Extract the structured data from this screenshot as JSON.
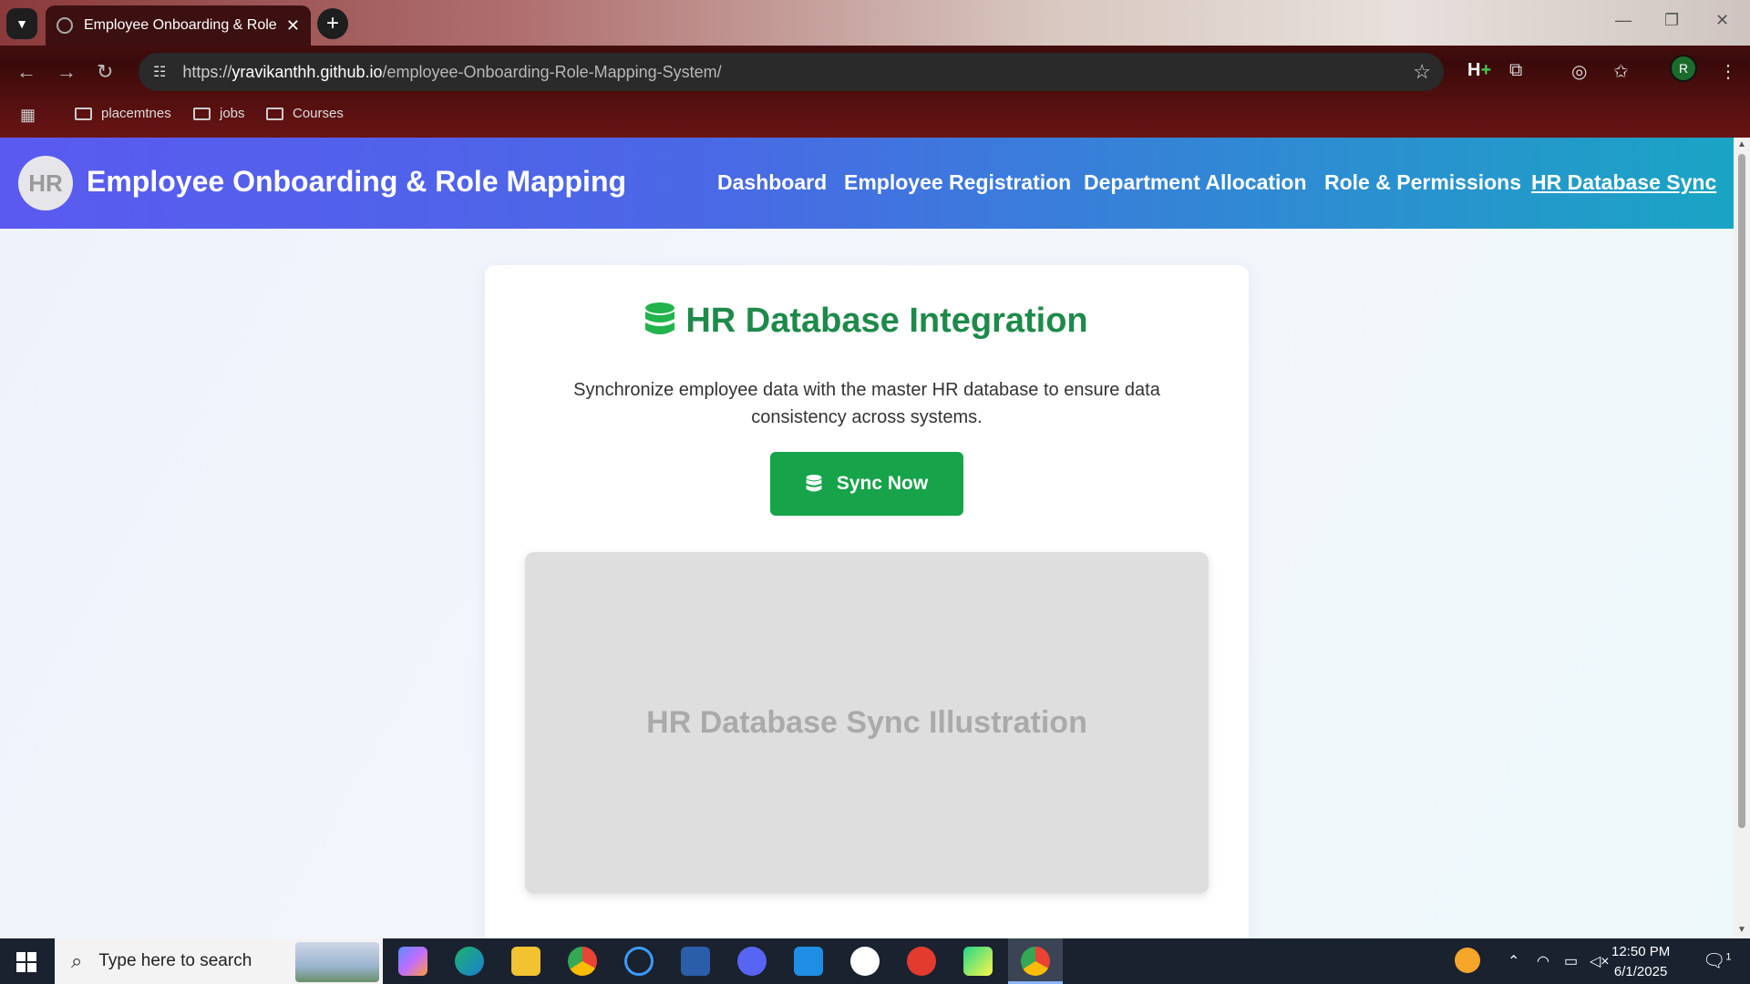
{
  "browser": {
    "tab_title": "Employee Onboarding & Role M",
    "url_scheme": "https://",
    "url_host": "yravikanthh.github.io",
    "url_path": "/employee-Onboarding-Role-Mapping-System/",
    "bookmarks": [
      "placemtnes",
      "jobs",
      "Courses"
    ],
    "profile_initial": "R",
    "extension_label": "H"
  },
  "app": {
    "logo_text": "HR",
    "brand": "Employee Onboarding & Role Mapping",
    "nav": [
      "Dashboard",
      "Employee Registration",
      "Department Allocation",
      "Role & Permissions",
      "HR Database Sync"
    ],
    "active_nav": "HR Database Sync"
  },
  "card": {
    "title": "HR Database Integration",
    "description": "Synchronize employee data with the master HR database to ensure data consistency across systems.",
    "button_label": "Sync Now",
    "illustration_text": "HR Database Sync Illustration"
  },
  "taskbar": {
    "search_placeholder": "Type here to search",
    "time": "12:50 PM",
    "date": "6/1/2025",
    "notification_count": "1"
  },
  "colors": {
    "accent_green": "#16a34a",
    "title_green": "#1e8a4a",
    "nav_gradient_start": "#5a5af0",
    "nav_gradient_end": "#1aa4c4"
  }
}
